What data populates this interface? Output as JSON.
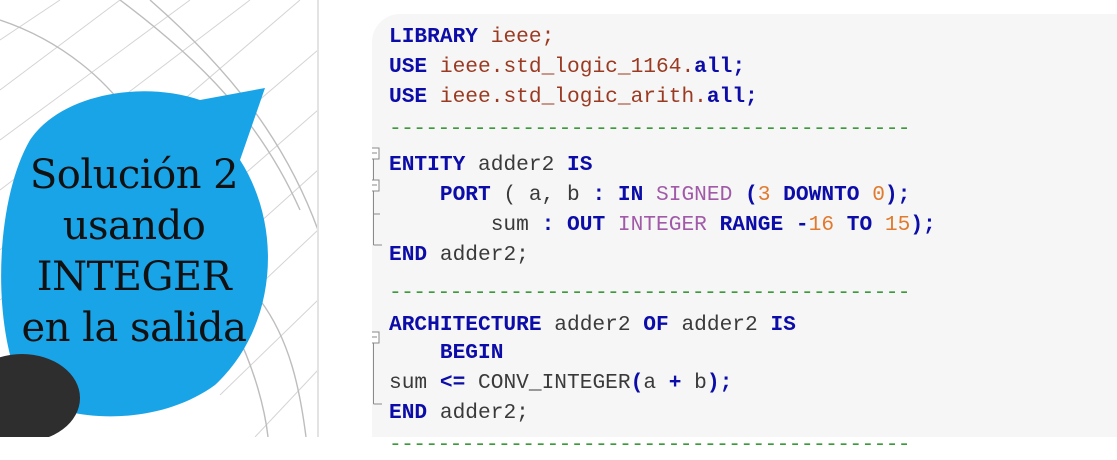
{
  "bubble": {
    "lines": [
      "Solución 2",
      "usando",
      "INTEGER",
      "en la salida"
    ],
    "color": "#1aa4e8"
  },
  "code": {
    "separator": "-------------------------------------------",
    "lines": [
      [
        {
          "t": "LIBRARY",
          "c": "kw"
        },
        {
          "t": " ieee;",
          "c": "lib"
        }
      ],
      [
        {
          "t": "USE",
          "c": "kw"
        },
        {
          "t": " ieee.std_logic_1164.",
          "c": "lib"
        },
        {
          "t": "all",
          "c": "kw"
        },
        {
          "t": ";",
          "c": "pu"
        }
      ],
      [
        {
          "t": "USE",
          "c": "kw"
        },
        {
          "t": " ieee.std_logic_arith.",
          "c": "lib"
        },
        {
          "t": "all",
          "c": "kw"
        },
        {
          "t": ";",
          "c": "pu"
        }
      ],
      [
        {
          "t": "-------------------------------------------",
          "c": "sep"
        }
      ],
      [
        {
          "t": "ENTITY",
          "c": "kw"
        },
        {
          "t": " adder2 ",
          "c": "id"
        },
        {
          "t": "IS",
          "c": "kw"
        }
      ],
      [
        {
          "t": "    PORT",
          "c": "kw"
        },
        {
          "t": " ( a, b ",
          "c": "id"
        },
        {
          "t": ":",
          "c": "pu"
        },
        {
          "t": " IN",
          "c": "kw"
        },
        {
          "t": " SIGNED ",
          "c": "ty"
        },
        {
          "t": "(",
          "c": "pu"
        },
        {
          "t": "3",
          "c": "num"
        },
        {
          "t": " DOWNTO ",
          "c": "kw"
        },
        {
          "t": "0",
          "c": "num"
        },
        {
          "t": ");",
          "c": "pu"
        }
      ],
      [
        {
          "t": "        sum ",
          "c": "id"
        },
        {
          "t": ":",
          "c": "pu"
        },
        {
          "t": " OUT",
          "c": "kw"
        },
        {
          "t": " INTEGER ",
          "c": "ty"
        },
        {
          "t": "RANGE",
          "c": "kw"
        },
        {
          "t": " -",
          "c": "pu"
        },
        {
          "t": "16",
          "c": "num"
        },
        {
          "t": " TO ",
          "c": "kw"
        },
        {
          "t": "15",
          "c": "num"
        },
        {
          "t": ");",
          "c": "pu"
        }
      ],
      [
        {
          "t": "END",
          "c": "kw"
        },
        {
          "t": " adder2;",
          "c": "id"
        }
      ],
      [
        {
          "t": "-------------------------------------------",
          "c": "sep"
        }
      ],
      [
        {
          "t": "ARCHITECTURE",
          "c": "kw"
        },
        {
          "t": " adder2 ",
          "c": "id"
        },
        {
          "t": "OF",
          "c": "kw"
        },
        {
          "t": " adder2 ",
          "c": "id"
        },
        {
          "t": "IS",
          "c": "kw"
        }
      ],
      [
        {
          "t": "    BEGIN",
          "c": "kw"
        }
      ],
      [
        {
          "t": "sum ",
          "c": "id"
        },
        {
          "t": "<=",
          "c": "pu"
        },
        {
          "t": " CONV_INTEGER",
          "c": "id"
        },
        {
          "t": "(",
          "c": "pu"
        },
        {
          "t": "a ",
          "c": "id"
        },
        {
          "t": "+",
          "c": "pu"
        },
        {
          "t": " b",
          "c": "id"
        },
        {
          "t": ");",
          "c": "pu"
        }
      ],
      [
        {
          "t": "END",
          "c": "kw"
        },
        {
          "t": " adder2;",
          "c": "id"
        }
      ],
      [
        {
          "t": "-------------------------------------------",
          "c": "sep"
        }
      ]
    ]
  }
}
